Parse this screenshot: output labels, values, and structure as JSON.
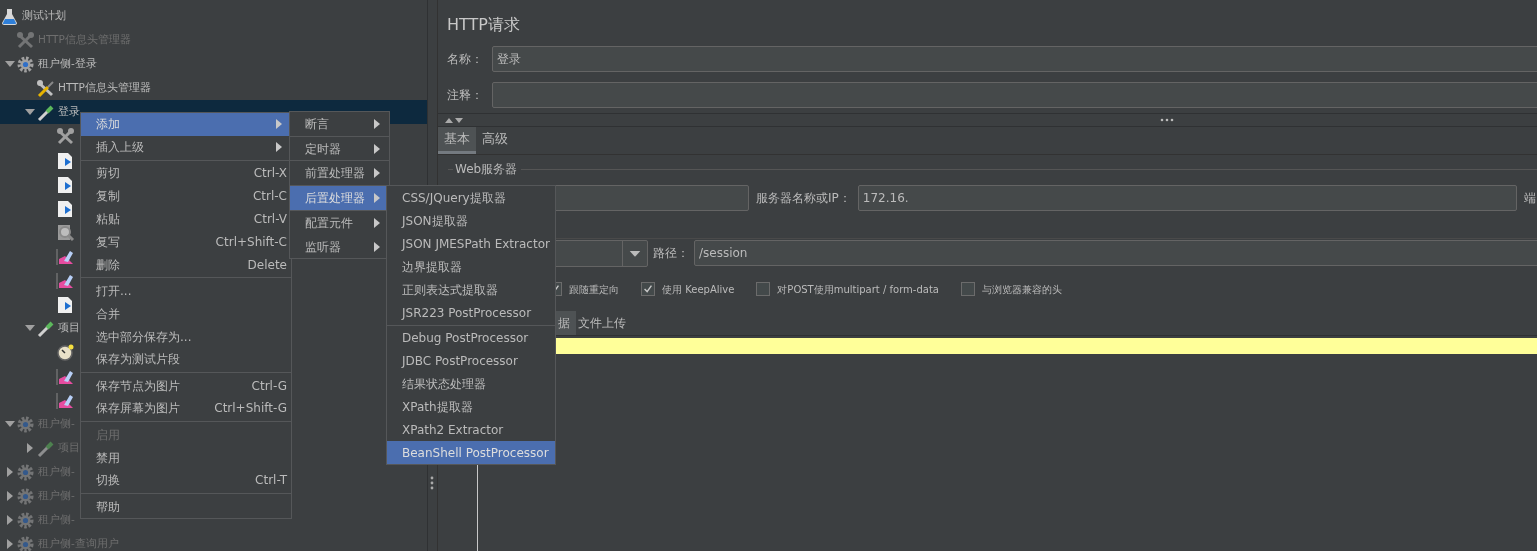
{
  "tree": [
    {
      "label": "测试计划",
      "kind": "flask",
      "selected": false,
      "disabled": false,
      "children": [
        {
          "label": "HTTP信息头管理器",
          "kind": "wrench",
          "selected": false,
          "disabled": true
        },
        {
          "label": "租户侧-登录",
          "kind": "gear",
          "selected": false,
          "disabled": false,
          "expanded": true,
          "children": [
            {
              "label": "HTTP信息头管理器",
              "kind": "tools",
              "selected": false,
              "disabled": false
            },
            {
              "label": "登录",
              "kind": "pipette",
              "selected": true,
              "disabled": false,
              "expanded": true,
              "children": [
                {
                  "kind": "wrench",
                  "selected": false,
                  "disabled": false
                },
                {
                  "kind": "document",
                  "selected": false,
                  "disabled": false
                },
                {
                  "kind": "document",
                  "selected": false,
                  "disabled": false
                },
                {
                  "kind": "document",
                  "selected": false,
                  "disabled": false
                },
                {
                  "kind": "magnifier",
                  "selected": false,
                  "disabled": false
                },
                {
                  "kind": "graph",
                  "selected": false,
                  "disabled": false
                },
                {
                  "kind": "graph",
                  "selected": false,
                  "disabled": false
                },
                {
                  "kind": "document",
                  "selected": false,
                  "disabled": false
                }
              ]
            },
            {
              "label": "项目",
              "kind": "pipette",
              "selected": false,
              "disabled": false,
              "expanded": true,
              "children": [
                {
                  "kind": "timer",
                  "selected": false,
                  "disabled": false
                },
                {
                  "kind": "graph",
                  "selected": false,
                  "disabled": false
                },
                {
                  "kind": "graph",
                  "selected": false,
                  "disabled": false
                }
              ]
            }
          ]
        },
        {
          "label": "租户侧-",
          "kind": "gear",
          "selected": false,
          "disabled": true,
          "expanded": true,
          "children": [
            {
              "label": "项目",
              "kind": "pipette",
              "selected": false,
              "disabled": true,
              "expanded": false
            }
          ]
        },
        {
          "label": "租户侧-",
          "kind": "gear",
          "selected": false,
          "disabled": true,
          "expanded": false
        },
        {
          "label": "租户侧-",
          "kind": "gear",
          "selected": false,
          "disabled": true,
          "expanded": false
        },
        {
          "label": "租户侧-",
          "kind": "gear",
          "selected": false,
          "disabled": true,
          "expanded": false
        },
        {
          "label": "租户侧-查询用户",
          "kind": "gear",
          "selected": false,
          "disabled": true,
          "expanded": false
        }
      ]
    }
  ],
  "panel": {
    "title": "HTTP请求",
    "name_label": "名称：",
    "name_value": "登录",
    "comment_label": "注释：",
    "tabs": [
      {
        "label": "基本",
        "selected": true
      },
      {
        "label": "高级",
        "selected": false
      }
    ],
    "web_server": {
      "legend": "Web服务器",
      "server_label": "服务器名称或IP：",
      "server_value": "172.16.",
      "port_label": "端"
    },
    "path_label": "路径：",
    "path_value": "/session",
    "options": [
      {
        "label": "跟随重定向",
        "checked": true
      },
      {
        "label": "使用 KeepAlive",
        "checked": true
      },
      {
        "label": "对POST使用multipart / form-data",
        "checked": false
      },
      {
        "label": "与浏览器兼容的头",
        "checked": false
      }
    ],
    "body_tabs": [
      {
        "label": "据",
        "selected": true
      },
      {
        "label": "文件上传",
        "selected": false
      }
    ]
  },
  "context_menu": {
    "groups": [
      [
        {
          "label": "添加",
          "submenu": true,
          "selected": true,
          "disabled": false
        },
        {
          "label": "插入上级",
          "submenu": true,
          "selected": false,
          "disabled": false
        }
      ],
      [
        {
          "label": "剪切",
          "shortcut": "Ctrl-X",
          "selected": false,
          "disabled": false
        },
        {
          "label": "复制",
          "shortcut": "Ctrl-C",
          "selected": false,
          "disabled": false
        },
        {
          "label": "粘贴",
          "shortcut": "Ctrl-V",
          "selected": false,
          "disabled": false
        },
        {
          "label": "复写",
          "shortcut": "Ctrl+Shift-C",
          "selected": false,
          "disabled": false
        },
        {
          "label": "删除",
          "shortcut": "Delete",
          "selected": false,
          "disabled": false
        }
      ],
      [
        {
          "label": "打开...",
          "selected": false,
          "disabled": false
        },
        {
          "label": "合并",
          "selected": false,
          "disabled": false
        },
        {
          "label": "选中部分保存为...",
          "selected": false,
          "disabled": false
        },
        {
          "label": "保存为测试片段",
          "selected": false,
          "disabled": false
        }
      ],
      [
        {
          "label": "保存节点为图片",
          "shortcut": "Ctrl-G",
          "selected": false,
          "disabled": false
        },
        {
          "label": "保存屏幕为图片",
          "shortcut": "Ctrl+Shift-G",
          "selected": false,
          "disabled": false
        }
      ],
      [
        {
          "label": "启用",
          "selected": false,
          "disabled": true
        },
        {
          "label": "禁用",
          "selected": false,
          "disabled": false
        },
        {
          "label": "切换",
          "shortcut": "Ctrl-T",
          "selected": false,
          "disabled": false
        }
      ],
      [
        {
          "label": "帮助",
          "selected": false,
          "disabled": false
        }
      ]
    ]
  },
  "add_submenu": {
    "groups": [
      [
        {
          "label": "断言",
          "submenu": true,
          "selected": false
        }
      ],
      [
        {
          "label": "定时器",
          "submenu": true,
          "selected": false
        }
      ],
      [
        {
          "label": "前置处理器",
          "submenu": true,
          "selected": false
        }
      ],
      [
        {
          "label": "后置处理器",
          "submenu": true,
          "selected": true
        }
      ],
      [
        {
          "label": "配置元件",
          "submenu": true,
          "selected": false
        },
        {
          "label": "监听器",
          "submenu": true,
          "selected": false
        }
      ]
    ]
  },
  "postprocessor_submenu": {
    "groups": [
      [
        {
          "label": "CSS/JQuery提取器",
          "selected": false
        },
        {
          "label": "JSON提取器",
          "selected": false
        },
        {
          "label": "JSON JMESPath Extractor",
          "selected": false
        },
        {
          "label": "边界提取器",
          "selected": false
        },
        {
          "label": "正则表达式提取器",
          "selected": false
        },
        {
          "label": "JSR223 PostProcessor",
          "selected": false
        }
      ],
      [
        {
          "label": "Debug PostProcessor",
          "selected": false
        },
        {
          "label": "JDBC PostProcessor",
          "selected": false
        },
        {
          "label": "结果状态处理器",
          "selected": false
        },
        {
          "label": "XPath提取器",
          "selected": false
        },
        {
          "label": "XPath2 Extractor",
          "selected": false
        },
        {
          "label": "BeanShell PostProcessor",
          "selected": true
        }
      ]
    ]
  }
}
